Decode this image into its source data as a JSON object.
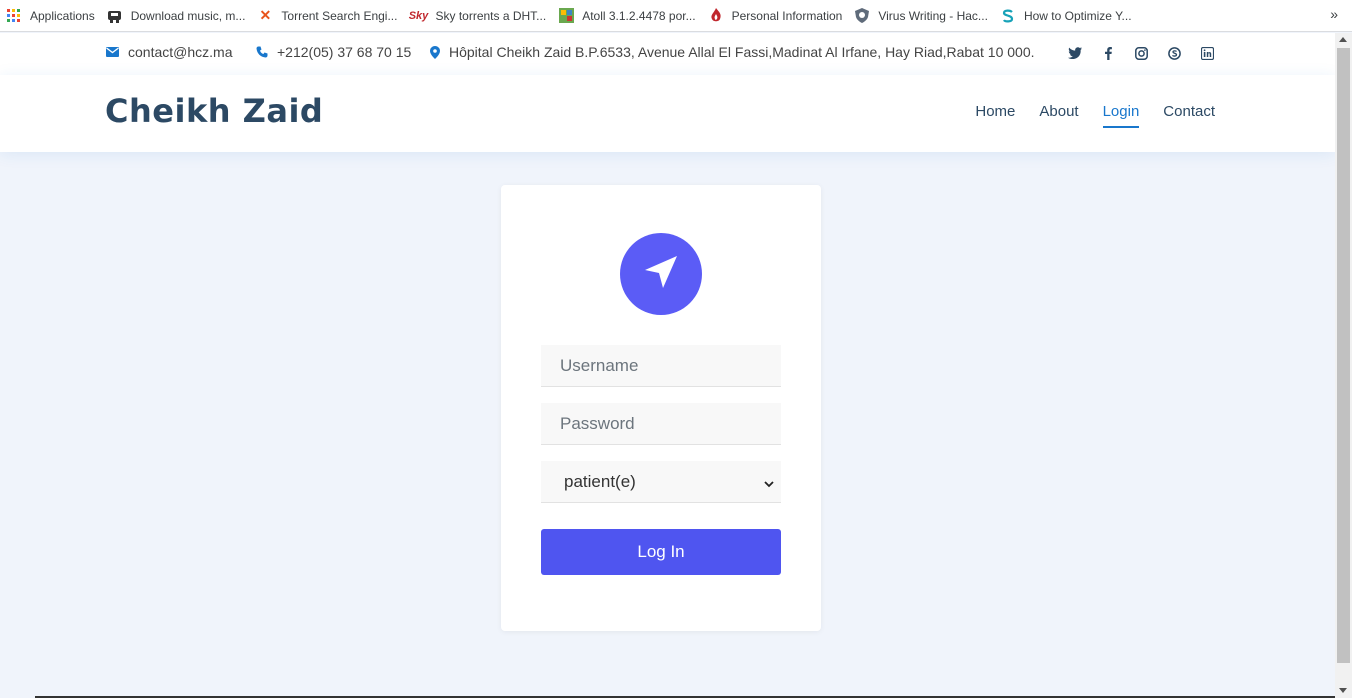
{
  "bookmarks": [
    {
      "label": "Applications",
      "icon": "apps-grid-icon"
    },
    {
      "label": "Download music, m...",
      "icon": "music-download-icon"
    },
    {
      "label": "Torrent Search Engi...",
      "icon": "x-logo-icon"
    },
    {
      "label": "Sky torrents a DHT...",
      "icon": "sky-logo-icon"
    },
    {
      "label": "Atoll 3.1.2.4478 por...",
      "icon": "atoll-icon"
    },
    {
      "label": "Personal Information",
      "icon": "flame-icon"
    },
    {
      "label": "Virus Writing - Hac...",
      "icon": "shield-icon"
    },
    {
      "label": "How to Optimize Y...",
      "icon": "s-logo-icon"
    }
  ],
  "bookmarks_more": "»",
  "topbar": {
    "email": "contact@hcz.ma",
    "phone": "+212(05) 37 68 70 15",
    "address": "Hôpital Cheikh Zaid B.P.6533, Avenue Allal El Fassi,Madinat Al Irfane, Hay Riad,Rabat 10 000."
  },
  "socials": [
    "twitter-icon",
    "facebook-icon",
    "instagram-icon",
    "skype-icon",
    "linkedin-icon"
  ],
  "header": {
    "logo": "Cheikh Zaid",
    "nav": [
      "Home",
      "About",
      "Login",
      "Contact"
    ],
    "active_nav": "Login"
  },
  "login": {
    "username_placeholder": "Username",
    "password_placeholder": "Password",
    "role_selected": "patient(e)",
    "submit_label": "Log In"
  },
  "colors": {
    "accent": "#1977cc",
    "heading": "#2c4964",
    "button": "#4f55f0",
    "brand_circle": "#5b5cf6",
    "page_bg": "#f0f4fb"
  }
}
